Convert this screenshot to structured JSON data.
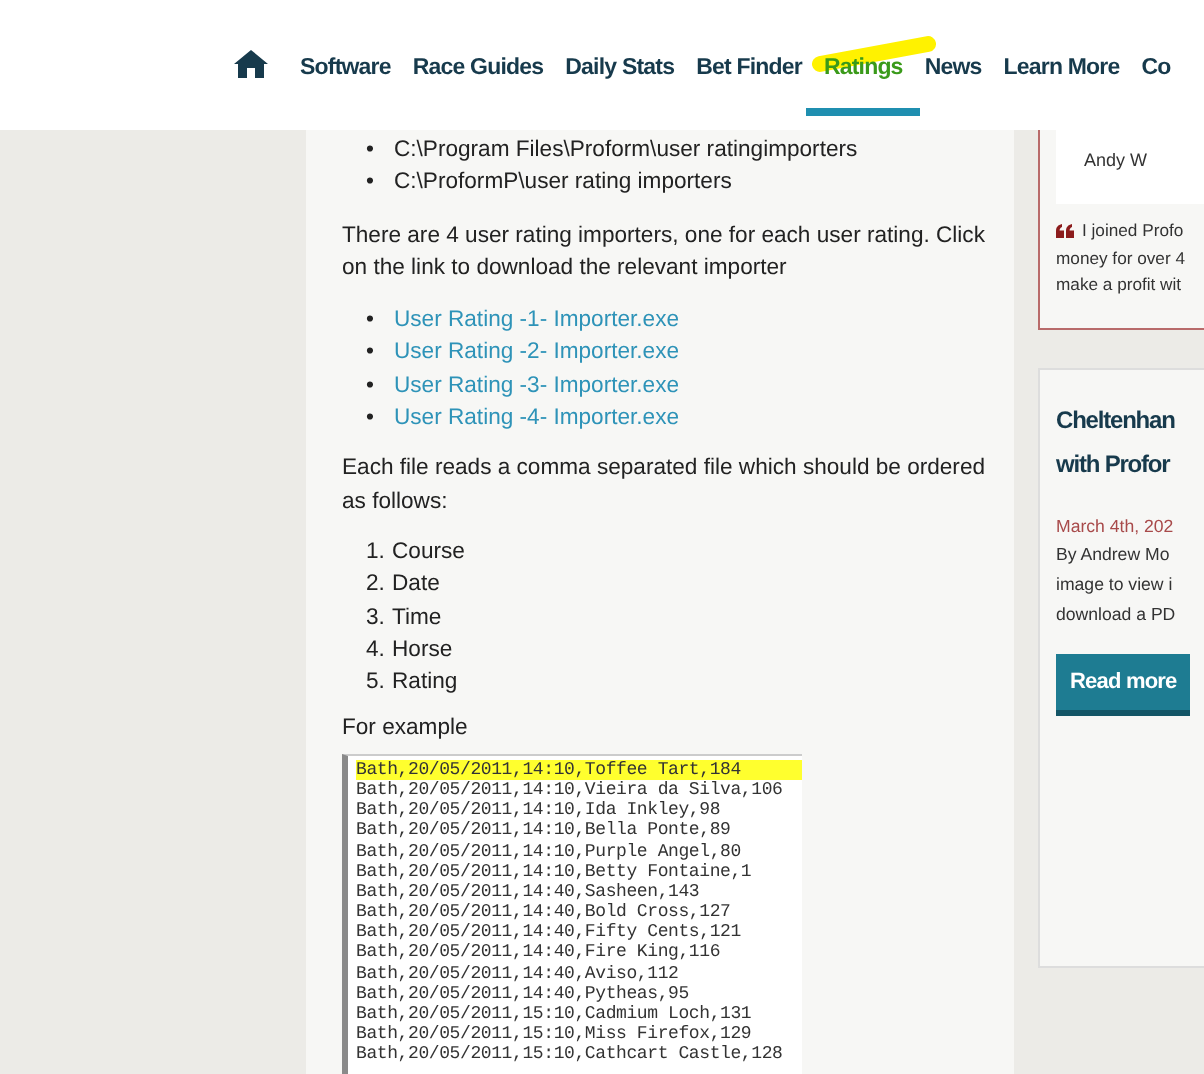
{
  "nav": {
    "items": [
      {
        "label": "Software",
        "selected": false
      },
      {
        "label": "Race Guides",
        "selected": false
      },
      {
        "label": "Daily Stats",
        "selected": false
      },
      {
        "label": "Bet Finder",
        "selected": false
      },
      {
        "label": "Ratings",
        "selected": true
      },
      {
        "label": "News",
        "selected": false
      },
      {
        "label": "Learn More",
        "selected": false
      },
      {
        "label": "Co",
        "selected": false
      }
    ]
  },
  "article": {
    "paths": [
      {
        "marker": "•",
        "text": "C:\\Program Files\\Proform\\user ratingimporters"
      },
      {
        "marker": "•",
        "text": "C:\\ProformP\\user rating importers"
      }
    ],
    "intro": "There are 4 user rating importers, one for each user rating. Click on the link to download the relevant importer",
    "downloads": [
      {
        "marker": "•",
        "text": "User Rating -1- Importer.exe"
      },
      {
        "marker": "•",
        "text": "User Rating -2- Importer.exe"
      },
      {
        "marker": "•",
        "text": "User Rating -3- Importer.exe"
      },
      {
        "marker": "•",
        "text": "User Rating -4- Importer.exe"
      }
    ],
    "format_note": "Each file reads a comma separated file which should be ordered as follows:",
    "fields": [
      {
        "marker": "1.",
        "text": "Course"
      },
      {
        "marker": "2.",
        "text": "Date"
      },
      {
        "marker": "3.",
        "text": "Time"
      },
      {
        "marker": "4.",
        "text": "Horse"
      },
      {
        "marker": "5.",
        "text": "Rating"
      }
    ],
    "example_label": "For example",
    "example_lines": [
      {
        "text": "Bath,20/05/2011,14:10,Toffee Tart,184",
        "selected": true
      },
      {
        "text": "Bath,20/05/2011,14:10,Vieira da Silva,106",
        "selected": false
      },
      {
        "text": "Bath,20/05/2011,14:10,Ida Inkley,98",
        "selected": false
      },
      {
        "text": "Bath,20/05/2011,14:10,Bella Ponte,89",
        "selected": false
      },
      {
        "text": "Bath,20/05/2011,14:10,Purple Angel,80",
        "selected": false
      },
      {
        "text": "Bath,20/05/2011,14:10,Betty Fontaine,1",
        "selected": false
      },
      {
        "text": "Bath,20/05/2011,14:40,Sasheen,143",
        "selected": false
      },
      {
        "text": "Bath,20/05/2011,14:40,Bold Cross,127",
        "selected": false
      },
      {
        "text": "Bath,20/05/2011,14:40,Fifty Cents,121",
        "selected": false
      },
      {
        "text": "Bath,20/05/2011,14:40,Fire King,116",
        "selected": false
      },
      {
        "text": "Bath,20/05/2011,14:40,Aviso,112",
        "selected": false
      },
      {
        "text": "Bath,20/05/2011,14:40,Pytheas,95",
        "selected": false
      },
      {
        "text": "Bath,20/05/2011,15:10,Cadmium Loch,131",
        "selected": false
      },
      {
        "text": "Bath,20/05/2011,15:10,Miss Firefox,129",
        "selected": false
      },
      {
        "text": "Bath,20/05/2011,15:10,Cathcart Castle,128",
        "selected": false
      }
    ]
  },
  "sidebar": {
    "testimonial": {
      "author": "Andy W",
      "quote_lines": [
        "I joined Profo",
        "money for over 4",
        "make a profit wit"
      ]
    },
    "post": {
      "title_lines": [
        "Cheltenhan",
        "with Profor"
      ],
      "date": "March 4th, 202",
      "excerpt_lines": [
        "By Andrew Mo",
        "image to view i",
        "download a PD"
      ],
      "button": "Read more"
    }
  }
}
